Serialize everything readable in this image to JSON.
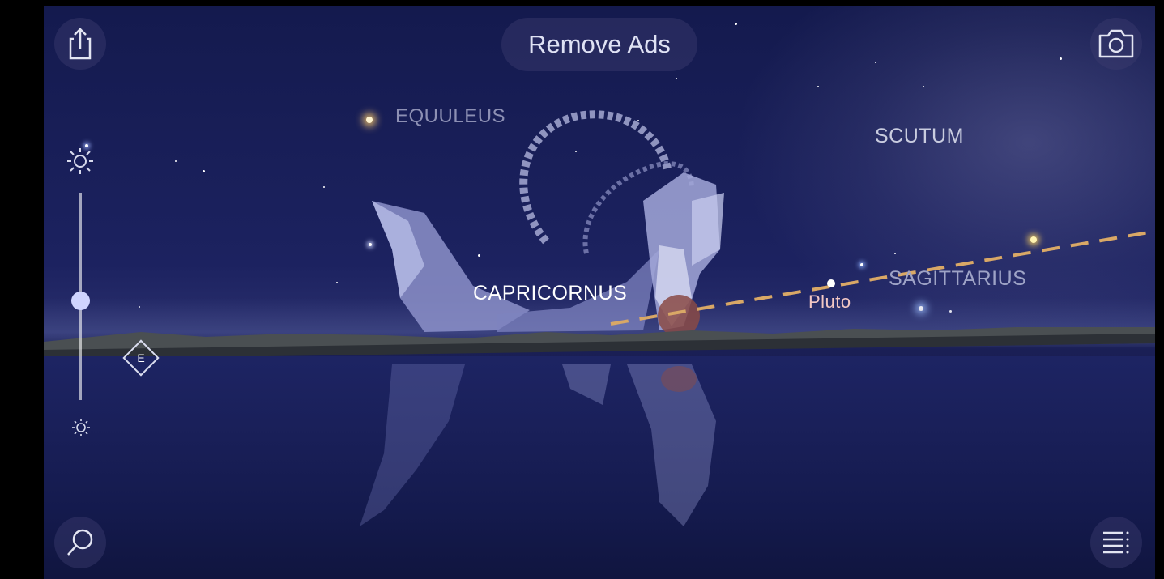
{
  "topbar": {
    "remove_ads_label": "Remove Ads",
    "share_icon": "share-icon",
    "camera_icon": "camera-icon"
  },
  "left_controls": {
    "brightness_high_icon": "sun-icon",
    "brightness_low_icon": "sun-small-icon",
    "brightness_level": 0.48,
    "compass_direction": "E"
  },
  "sky": {
    "labels": {
      "equuleus": "EQUULEUS",
      "scutum": "SCUTUM",
      "sagittarius": "SAGITTARIUS",
      "capricornus": "CAPRICORNUS",
      "pluto": "Pluto"
    }
  },
  "bottom": {
    "search_icon": "search-icon",
    "menu_icon": "menu-icon"
  },
  "colors": {
    "sky": "#1c2260",
    "ecliptic": "#d9a866",
    "label": "#c9ccdf",
    "pluto_label": "#f3c8c4"
  }
}
